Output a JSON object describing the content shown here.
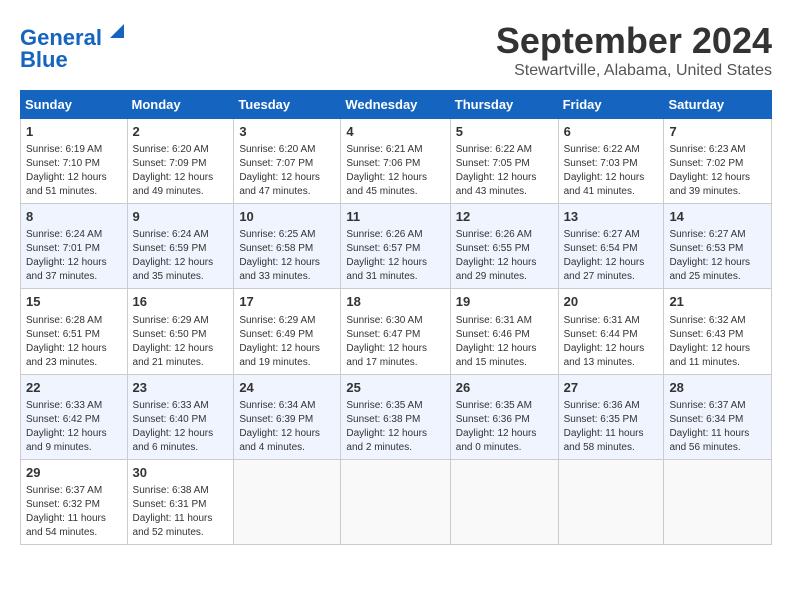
{
  "logo": {
    "line1": "General",
    "line2": "Blue"
  },
  "title": "September 2024",
  "subtitle": "Stewartville, Alabama, United States",
  "headers": [
    "Sunday",
    "Monday",
    "Tuesday",
    "Wednesday",
    "Thursday",
    "Friday",
    "Saturday"
  ],
  "weeks": [
    [
      {
        "day": "1",
        "sunrise": "6:19 AM",
        "sunset": "7:10 PM",
        "daylight": "12 hours and 51 minutes."
      },
      {
        "day": "2",
        "sunrise": "6:20 AM",
        "sunset": "7:09 PM",
        "daylight": "12 hours and 49 minutes."
      },
      {
        "day": "3",
        "sunrise": "6:20 AM",
        "sunset": "7:07 PM",
        "daylight": "12 hours and 47 minutes."
      },
      {
        "day": "4",
        "sunrise": "6:21 AM",
        "sunset": "7:06 PM",
        "daylight": "12 hours and 45 minutes."
      },
      {
        "day": "5",
        "sunrise": "6:22 AM",
        "sunset": "7:05 PM",
        "daylight": "12 hours and 43 minutes."
      },
      {
        "day": "6",
        "sunrise": "6:22 AM",
        "sunset": "7:03 PM",
        "daylight": "12 hours and 41 minutes."
      },
      {
        "day": "7",
        "sunrise": "6:23 AM",
        "sunset": "7:02 PM",
        "daylight": "12 hours and 39 minutes."
      }
    ],
    [
      {
        "day": "8",
        "sunrise": "6:24 AM",
        "sunset": "7:01 PM",
        "daylight": "12 hours and 37 minutes."
      },
      {
        "day": "9",
        "sunrise": "6:24 AM",
        "sunset": "6:59 PM",
        "daylight": "12 hours and 35 minutes."
      },
      {
        "day": "10",
        "sunrise": "6:25 AM",
        "sunset": "6:58 PM",
        "daylight": "12 hours and 33 minutes."
      },
      {
        "day": "11",
        "sunrise": "6:26 AM",
        "sunset": "6:57 PM",
        "daylight": "12 hours and 31 minutes."
      },
      {
        "day": "12",
        "sunrise": "6:26 AM",
        "sunset": "6:55 PM",
        "daylight": "12 hours and 29 minutes."
      },
      {
        "day": "13",
        "sunrise": "6:27 AM",
        "sunset": "6:54 PM",
        "daylight": "12 hours and 27 minutes."
      },
      {
        "day": "14",
        "sunrise": "6:27 AM",
        "sunset": "6:53 PM",
        "daylight": "12 hours and 25 minutes."
      }
    ],
    [
      {
        "day": "15",
        "sunrise": "6:28 AM",
        "sunset": "6:51 PM",
        "daylight": "12 hours and 23 minutes."
      },
      {
        "day": "16",
        "sunrise": "6:29 AM",
        "sunset": "6:50 PM",
        "daylight": "12 hours and 21 minutes."
      },
      {
        "day": "17",
        "sunrise": "6:29 AM",
        "sunset": "6:49 PM",
        "daylight": "12 hours and 19 minutes."
      },
      {
        "day": "18",
        "sunrise": "6:30 AM",
        "sunset": "6:47 PM",
        "daylight": "12 hours and 17 minutes."
      },
      {
        "day": "19",
        "sunrise": "6:31 AM",
        "sunset": "6:46 PM",
        "daylight": "12 hours and 15 minutes."
      },
      {
        "day": "20",
        "sunrise": "6:31 AM",
        "sunset": "6:44 PM",
        "daylight": "12 hours and 13 minutes."
      },
      {
        "day": "21",
        "sunrise": "6:32 AM",
        "sunset": "6:43 PM",
        "daylight": "12 hours and 11 minutes."
      }
    ],
    [
      {
        "day": "22",
        "sunrise": "6:33 AM",
        "sunset": "6:42 PM",
        "daylight": "12 hours and 9 minutes."
      },
      {
        "day": "23",
        "sunrise": "6:33 AM",
        "sunset": "6:40 PM",
        "daylight": "12 hours and 6 minutes."
      },
      {
        "day": "24",
        "sunrise": "6:34 AM",
        "sunset": "6:39 PM",
        "daylight": "12 hours and 4 minutes."
      },
      {
        "day": "25",
        "sunrise": "6:35 AM",
        "sunset": "6:38 PM",
        "daylight": "12 hours and 2 minutes."
      },
      {
        "day": "26",
        "sunrise": "6:35 AM",
        "sunset": "6:36 PM",
        "daylight": "12 hours and 0 minutes."
      },
      {
        "day": "27",
        "sunrise": "6:36 AM",
        "sunset": "6:35 PM",
        "daylight": "11 hours and 58 minutes."
      },
      {
        "day": "28",
        "sunrise": "6:37 AM",
        "sunset": "6:34 PM",
        "daylight": "11 hours and 56 minutes."
      }
    ],
    [
      {
        "day": "29",
        "sunrise": "6:37 AM",
        "sunset": "6:32 PM",
        "daylight": "11 hours and 54 minutes."
      },
      {
        "day": "30",
        "sunrise": "6:38 AM",
        "sunset": "6:31 PM",
        "daylight": "11 hours and 52 minutes."
      },
      {
        "day": "",
        "sunrise": "",
        "sunset": "",
        "daylight": ""
      },
      {
        "day": "",
        "sunrise": "",
        "sunset": "",
        "daylight": ""
      },
      {
        "day": "",
        "sunrise": "",
        "sunset": "",
        "daylight": ""
      },
      {
        "day": "",
        "sunrise": "",
        "sunset": "",
        "daylight": ""
      },
      {
        "day": "",
        "sunrise": "",
        "sunset": "",
        "daylight": ""
      }
    ]
  ],
  "labels": {
    "sunrise": "Sunrise:",
    "sunset": "Sunset:",
    "daylight": "Daylight:"
  }
}
